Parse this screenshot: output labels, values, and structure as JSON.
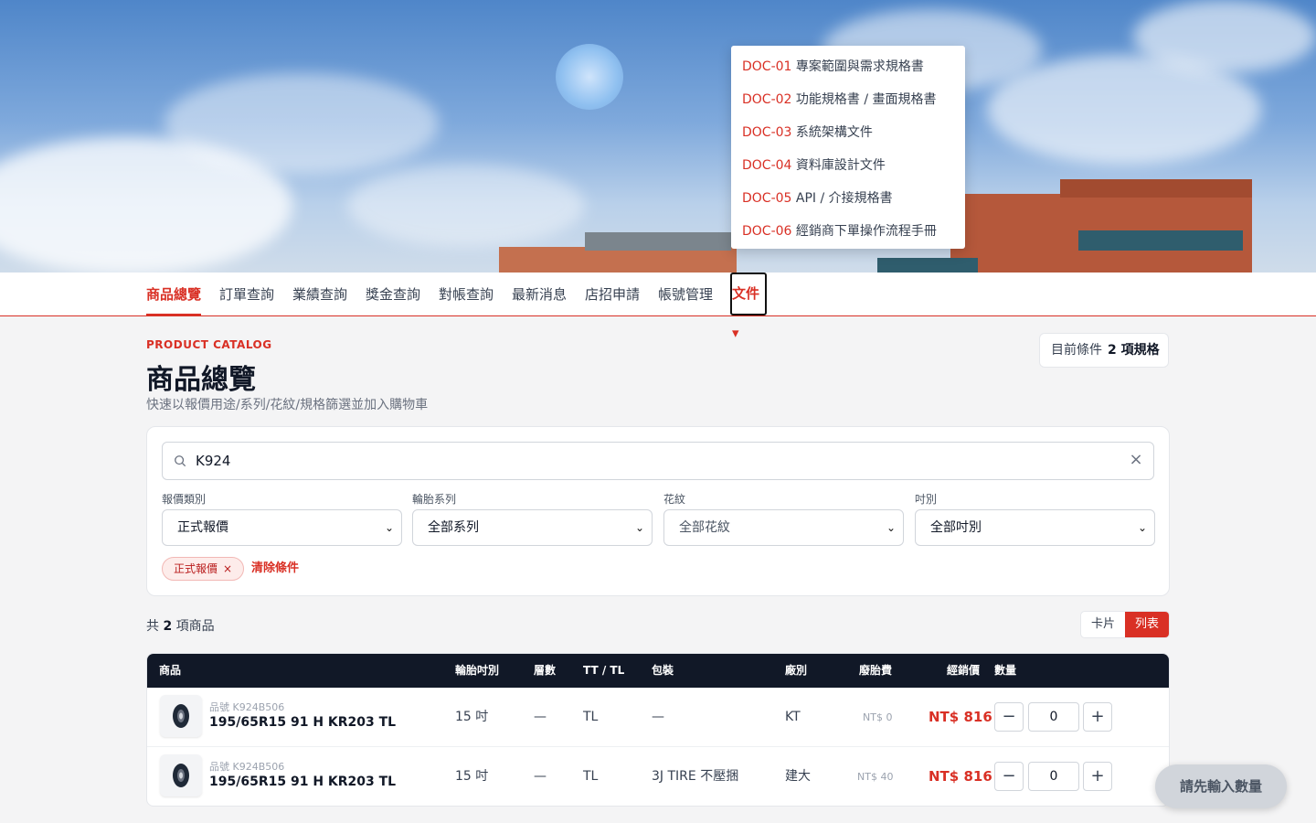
{
  "nav": {
    "items": [
      "商品總覽",
      "訂單查詢",
      "業績查詢",
      "獎金查詢",
      "對帳查詢",
      "最新消息",
      "店招申請",
      "帳號管理"
    ],
    "doc_label": "文件▾"
  },
  "docs_menu": [
    {
      "code": "DOC-01",
      "label": "專案範圍與需求規格書"
    },
    {
      "code": "DOC-02",
      "label": "功能規格書 / 畫面規格書"
    },
    {
      "code": "DOC-03",
      "label": "系統架構文件"
    },
    {
      "code": "DOC-04",
      "label": "資料庫設計文件"
    },
    {
      "code": "DOC-05",
      "label": "API / 介接規格書"
    },
    {
      "code": "DOC-06",
      "label": "經銷商下單操作流程手冊"
    }
  ],
  "header": {
    "eyebrow": "PRODUCT CATALOG",
    "title": "商品總覽",
    "subtitle": "快速以報價用途/系列/花紋/規格篩選並加入購物車",
    "cond_label": "目前條件",
    "cond_value": "2 項規格"
  },
  "filters": {
    "search_value": "K924",
    "quote_type": {
      "label": "報價類別",
      "value": "正式報價"
    },
    "series": {
      "label": "輪胎系列",
      "value": "全部系列"
    },
    "pattern": {
      "label": "花紋",
      "value": "全部花紋"
    },
    "size": {
      "label": "吋別",
      "value": "全部吋別"
    },
    "chip": "正式報價",
    "clear_label": "清除條件"
  },
  "results": {
    "prefix": "共",
    "count": "2",
    "suffix": "項商品",
    "view_card": "卡片",
    "view_list": "列表"
  },
  "table": {
    "headers": [
      "商品",
      "輪胎吋別",
      "層數",
      "TT / TL",
      "包裝",
      "廠別",
      "廢胎費",
      "經銷價",
      "數量"
    ],
    "rows": [
      {
        "sku": "品號 K924B506",
        "name": "195/65R15 91 H KR203 TL",
        "size": "15 吋",
        "ply": "—",
        "tttl": "TL",
        "pack": "—",
        "factory": "KT",
        "fee": "NT$ 0",
        "price": "NT$ 816",
        "qty": "0"
      },
      {
        "sku": "品號 K924B506",
        "name": "195/65R15 91 H KR203 TL",
        "size": "15 吋",
        "ply": "—",
        "tttl": "TL",
        "pack": "3J TIRE 不壓捆",
        "factory": "建大",
        "fee": "NT$ 40",
        "price": "NT$ 816",
        "qty": "0"
      }
    ]
  },
  "float_button": "請先輸入數量",
  "colors": {
    "accent": "#d93025",
    "table_header": "#111827"
  }
}
